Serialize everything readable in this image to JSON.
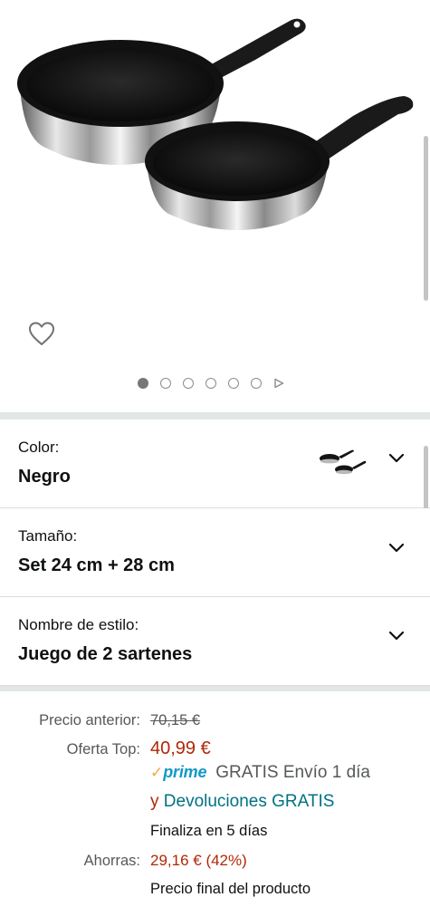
{
  "gallery": {
    "image_alt": "Set de 2 sartenes negras",
    "wishlist_icon": "heart-outline-icon",
    "dot_count": 6,
    "active_dot": 0,
    "video_icon": "play-triangle-icon"
  },
  "variations": [
    {
      "label": "Color:",
      "value": "Negro"
    },
    {
      "label": "Tamaño:",
      "value": "Set 24 cm + 28 cm"
    },
    {
      "label": "Nombre de estilo:",
      "value": "Juego de 2 sartenes"
    }
  ],
  "price": {
    "old_label": "Precio anterior:",
    "old_value": "70,15 €",
    "deal_label": "Oferta Top:",
    "deal_value": "40,99 €",
    "prime_check": "✓",
    "prime_word": "prime",
    "delivery_text": "GRATIS Envío 1 día",
    "returns_prefix": "y",
    "returns_link": "Devoluciones GRATIS",
    "finish_text": "Finaliza en 5 días",
    "savings_label": "Ahorras:",
    "savings_value": "29,16 € (42%)",
    "final_text": "Precio final del producto"
  },
  "colors": {
    "deal_red": "#b12704",
    "link_teal": "#007185",
    "prime_blue": "#1399c6",
    "prime_orange": "#f3a847",
    "divider_gray": "#e3e6e6"
  }
}
